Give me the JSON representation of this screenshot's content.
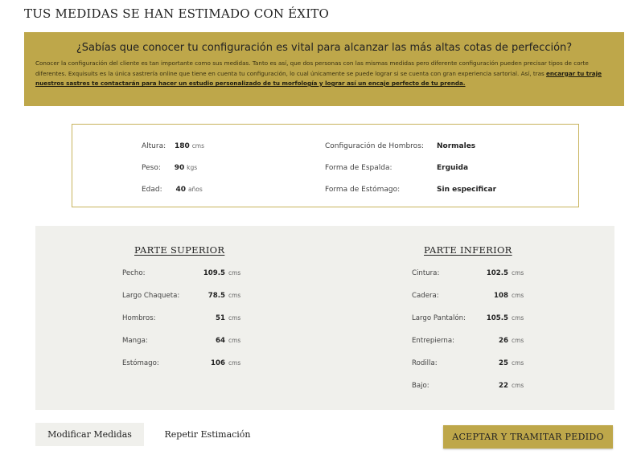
{
  "page_title": "TUS MEDIDAS SE HAN ESTIMADO CON ÉXITO",
  "info": {
    "heading": "¿Sabías que conocer tu configuración es vital para alcanzar las más altas cotas de perfección?",
    "body": "Conocer la configuración del cliente es tan importante como sus medidas. Tanto es así, que dos personas con las mismas medidas pero diferente configuración pueden precisar tipos de corte diferentes. Exquisuits es la única sastrería online que tiene en cuenta tu configuración, lo cual únicamente se puede lograr si se cuenta con gran experiencia sartorial. Así, tras ",
    "link": "encargar tu traje nuestros sastres te contactarán para hacer un estudio personalizado de tu morfología y lograr así un encaje perfecto de tu prenda."
  },
  "profile": {
    "left": [
      {
        "label": "Altura:",
        "value": "180",
        "unit": "cms"
      },
      {
        "label": "Peso:",
        "value": "90",
        "unit": "kgs"
      },
      {
        "label": "Edad:",
        "value": "40",
        "unit": "años"
      }
    ],
    "right": [
      {
        "label": "Configuración de Hombros:",
        "value": "Normales"
      },
      {
        "label": "Forma de Espalda:",
        "value": "Erguida"
      },
      {
        "label": "Forma de Estómago:",
        "value": "Sin especificar"
      }
    ]
  },
  "upper": {
    "title": "PARTE SUPERIOR",
    "rows": [
      {
        "label": "Pecho:",
        "value": "109.5",
        "unit": "cms"
      },
      {
        "label": "Largo Chaqueta:",
        "value": "78.5",
        "unit": "cms"
      },
      {
        "label": "Hombros:",
        "value": "51",
        "unit": "cms"
      },
      {
        "label": "Manga:",
        "value": "64",
        "unit": "cms"
      },
      {
        "label": "Estómago:",
        "value": "106",
        "unit": "cms"
      }
    ]
  },
  "lower": {
    "title": "PARTE INFERIOR",
    "rows": [
      {
        "label": "Cintura:",
        "value": "102.5",
        "unit": "cms"
      },
      {
        "label": "Cadera:",
        "value": "108",
        "unit": "cms"
      },
      {
        "label": "Largo Pantalón:",
        "value": "105.5",
        "unit": "cms"
      },
      {
        "label": "Entrepierna:",
        "value": "26",
        "unit": "cms"
      },
      {
        "label": "Rodilla:",
        "value": "25",
        "unit": "cms"
      },
      {
        "label": "Bajo:",
        "value": "22",
        "unit": "cms"
      }
    ]
  },
  "buttons": {
    "modify": "Modificar Medidas",
    "repeat": "Repetir Estimación",
    "accept": "ACEPTAR Y TRAMITAR PEDIDO"
  },
  "colors": {
    "accent": "#bea74a",
    "panel": "#f0f0ec"
  }
}
